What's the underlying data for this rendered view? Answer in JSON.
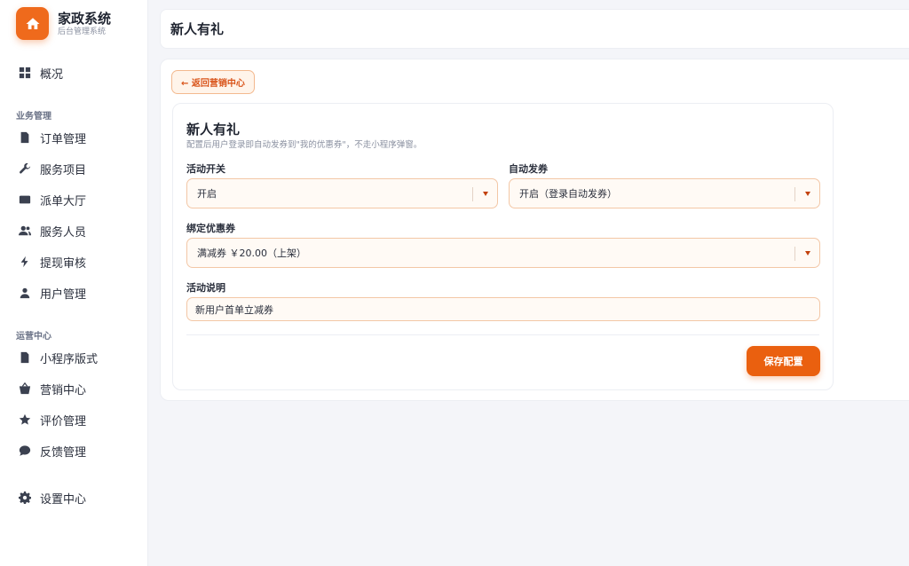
{
  "brand": {
    "title": "家政系统",
    "subtitle": "后台管理系统",
    "icon": "home-icon",
    "accent": "#ef6a1c"
  },
  "sidebar": {
    "overview": {
      "label": "概况",
      "icon": "grid-icon"
    },
    "section_business": "业务管理",
    "business_items": [
      {
        "label": "订单管理",
        "icon": "document-icon"
      },
      {
        "label": "服务项目",
        "icon": "wrench-icon"
      },
      {
        "label": "派单大厅",
        "icon": "folder-icon"
      },
      {
        "label": "服务人员",
        "icon": "users-icon"
      },
      {
        "label": "提现审核",
        "icon": "bolt-icon"
      },
      {
        "label": "用户管理",
        "icon": "user-icon"
      }
    ],
    "section_ops": "运营中心",
    "ops_items": [
      {
        "label": "小程序版式",
        "icon": "document-icon"
      },
      {
        "label": "营销中心",
        "icon": "basket-icon"
      },
      {
        "label": "评价管理",
        "icon": "star-icon"
      },
      {
        "label": "反馈管理",
        "icon": "chat-icon"
      }
    ],
    "settings": {
      "label": "设置中心",
      "icon": "gear-icon"
    }
  },
  "header": {
    "title": "新人有礼"
  },
  "main": {
    "back_label": "← 返回营销中心",
    "card": {
      "title": "新人有礼",
      "description": "配置后用户登录即自动发券到\"我的优惠券\"，不走小程序弹窗。",
      "activity_switch": {
        "label": "活动开关",
        "value": "开启"
      },
      "auto_issue": {
        "label": "自动发券",
        "value": "开启（登录自动发券）"
      },
      "coupon": {
        "label": "绑定优惠券",
        "value": "满减券 ￥20.00（上架）"
      },
      "description_field": {
        "label": "活动说明",
        "value": "新用户首单立减券"
      },
      "save_label": "保存配置"
    }
  }
}
